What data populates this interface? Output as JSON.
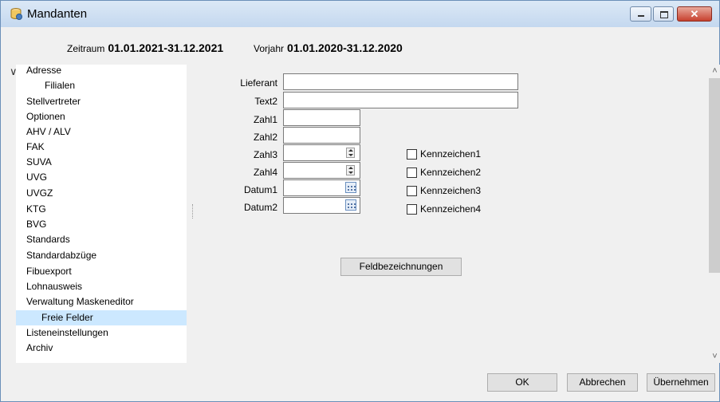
{
  "window": {
    "title": "Mandanten",
    "close_glyph": "✕"
  },
  "period": {
    "zeitraum_label": "Zeitraum",
    "zeitraum_value": "01.01.2021-31.12.2021",
    "vorjahr_label": "Vorjahr",
    "vorjahr_value": "01.01.2020-31.12.2020"
  },
  "sidebar": {
    "expand_glyph": "∨",
    "items": [
      "Adresse",
      "Filialen",
      "Stellvertreter",
      "Optionen",
      "AHV / ALV",
      "FAK",
      "SUVA",
      "UVG",
      "UVGZ",
      "KTG",
      "BVG",
      "Standards",
      "Standardabzüge",
      "Fibuexport",
      "Lohnausweis",
      "Verwaltung Maskeneditor",
      "Freie Felder",
      "Listeneinstellungen",
      "Archiv"
    ],
    "selected": "Freie Felder"
  },
  "form": {
    "lieferant_label": "Lieferant",
    "lieferant_value": "",
    "text2_label": "Text2",
    "text2_value": "",
    "zahl1_label": "Zahl1",
    "zahl1_value": "",
    "zahl2_label": "Zahl2",
    "zahl2_value": "",
    "zahl3_label": "Zahl3",
    "zahl3_value": "",
    "zahl4_label": "Zahl4",
    "zahl4_value": "",
    "datum1_label": "Datum1",
    "datum1_value": "",
    "datum2_label": "Datum2",
    "datum2_value": ""
  },
  "checkboxes": [
    {
      "label": "Kennzeichen1",
      "checked": false
    },
    {
      "label": "Kennzeichen2",
      "checked": false
    },
    {
      "label": "Kennzeichen3",
      "checked": false
    },
    {
      "label": "Kennzeichen4",
      "checked": false
    }
  ],
  "buttons": {
    "feldbezeichnungen": "Feldbezeichnungen",
    "ok": "OK",
    "abbrechen": "Abbrechen",
    "uebernehmen": "Übernehmen"
  },
  "scrollbar": {
    "up_glyph": "˄",
    "down_glyph": "˅"
  },
  "colors": {
    "selection": "#cce8ff",
    "titlebar": "#c4d8ef",
    "close_button": "#c7412e"
  }
}
